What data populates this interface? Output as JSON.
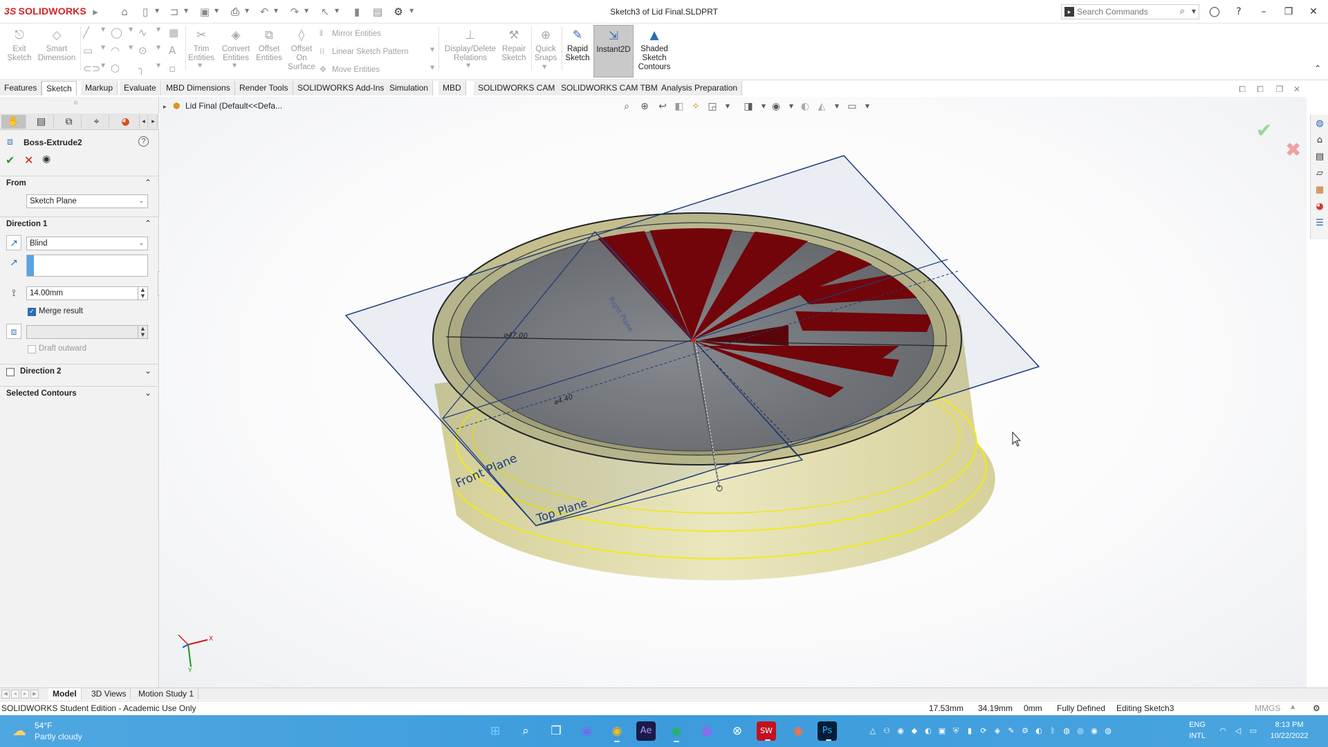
{
  "app": {
    "brand": "SOLIDWORKS",
    "window_title": "Sketch3 of Lid Final.SLDPRT",
    "search_placeholder": "Search Commands"
  },
  "commands": {
    "exit_sketch": "Exit\nSketch",
    "smart_dimension": "Smart\nDimension",
    "trim_entities": "Trim\nEntities",
    "convert_entities": "Convert\nEntities",
    "offset_entities": "Offset\nEntities",
    "offset_on_surface": "Offset\nOn\nSurface",
    "mirror_entities": "Mirror Entities",
    "linear_sketch_pattern": "Linear Sketch Pattern",
    "move_entities": "Move Entities",
    "display_delete_relations": "Display/Delete\nRelations",
    "repair_sketch": "Repair\nSketch",
    "quick_snaps": "Quick\nSnaps",
    "rapid_sketch": "Rapid\nSketch",
    "instant2d": "Instant2D",
    "shaded_sketch_contours": "Shaded\nSketch\nContours"
  },
  "tabs": [
    "Features",
    "Sketch",
    "Markup",
    "Evaluate",
    "MBD Dimensions",
    "Render Tools",
    "SOLIDWORKS Add-Ins",
    "Simulation",
    "MBD",
    "SOLIDWORKS CAM",
    "SOLIDWORKS CAM TBM",
    "Analysis Preparation"
  ],
  "property_manager": {
    "title": "Boss-Extrude2",
    "from": {
      "label": "From",
      "value": "Sketch Plane"
    },
    "direction1": {
      "label": "Direction 1",
      "end_condition": "Blind",
      "direction_value": "",
      "depth": "14.00mm",
      "merge_result_label": "Merge result",
      "merge_result_checked": true,
      "draft_value": "",
      "draft_outward_label": "Draft outward",
      "draft_outward_checked": false
    },
    "direction2": {
      "label": "Direction 2",
      "checked": false
    },
    "selected_contours": {
      "label": "Selected Contours"
    }
  },
  "tree": {
    "part_label": "Lid Final  (Default<<Defa..."
  },
  "viewport_labels": {
    "front_plane": "Front Plane",
    "top_plane": "Top Plane",
    "dim_diameter_1": "⌀47.00",
    "dim_diameter_2": "⌀4.40",
    "right_plane_rotated": "Right Plane",
    "triad_x": "X",
    "triad_y": "Y"
  },
  "model_tabs": [
    "Model",
    "3D Views",
    "Motion Study 1"
  ],
  "status": {
    "edition": "SOLIDWORKS Student Edition - Academic Use Only",
    "x": "17.53mm",
    "y": "34.19mm",
    "z": "0mm",
    "defined": "Fully Defined",
    "editing": "Editing Sketch3",
    "units": "MMGS"
  },
  "taskbar": {
    "weather_temp": "54°F",
    "weather_desc": "Partly cloudy",
    "lang1": "ENG",
    "lang2": "INTL",
    "time": "8:13 PM",
    "date": "10/22/2022"
  },
  "colors": {
    "brand_red": "#d2232a",
    "part_yellow": "#d8d39a",
    "selection_yellow": "#f2ea16",
    "sketch_blue": "#1f3c7a",
    "cutout_red": "#7a0000",
    "taskbar_blue": "#3d9bdc"
  }
}
